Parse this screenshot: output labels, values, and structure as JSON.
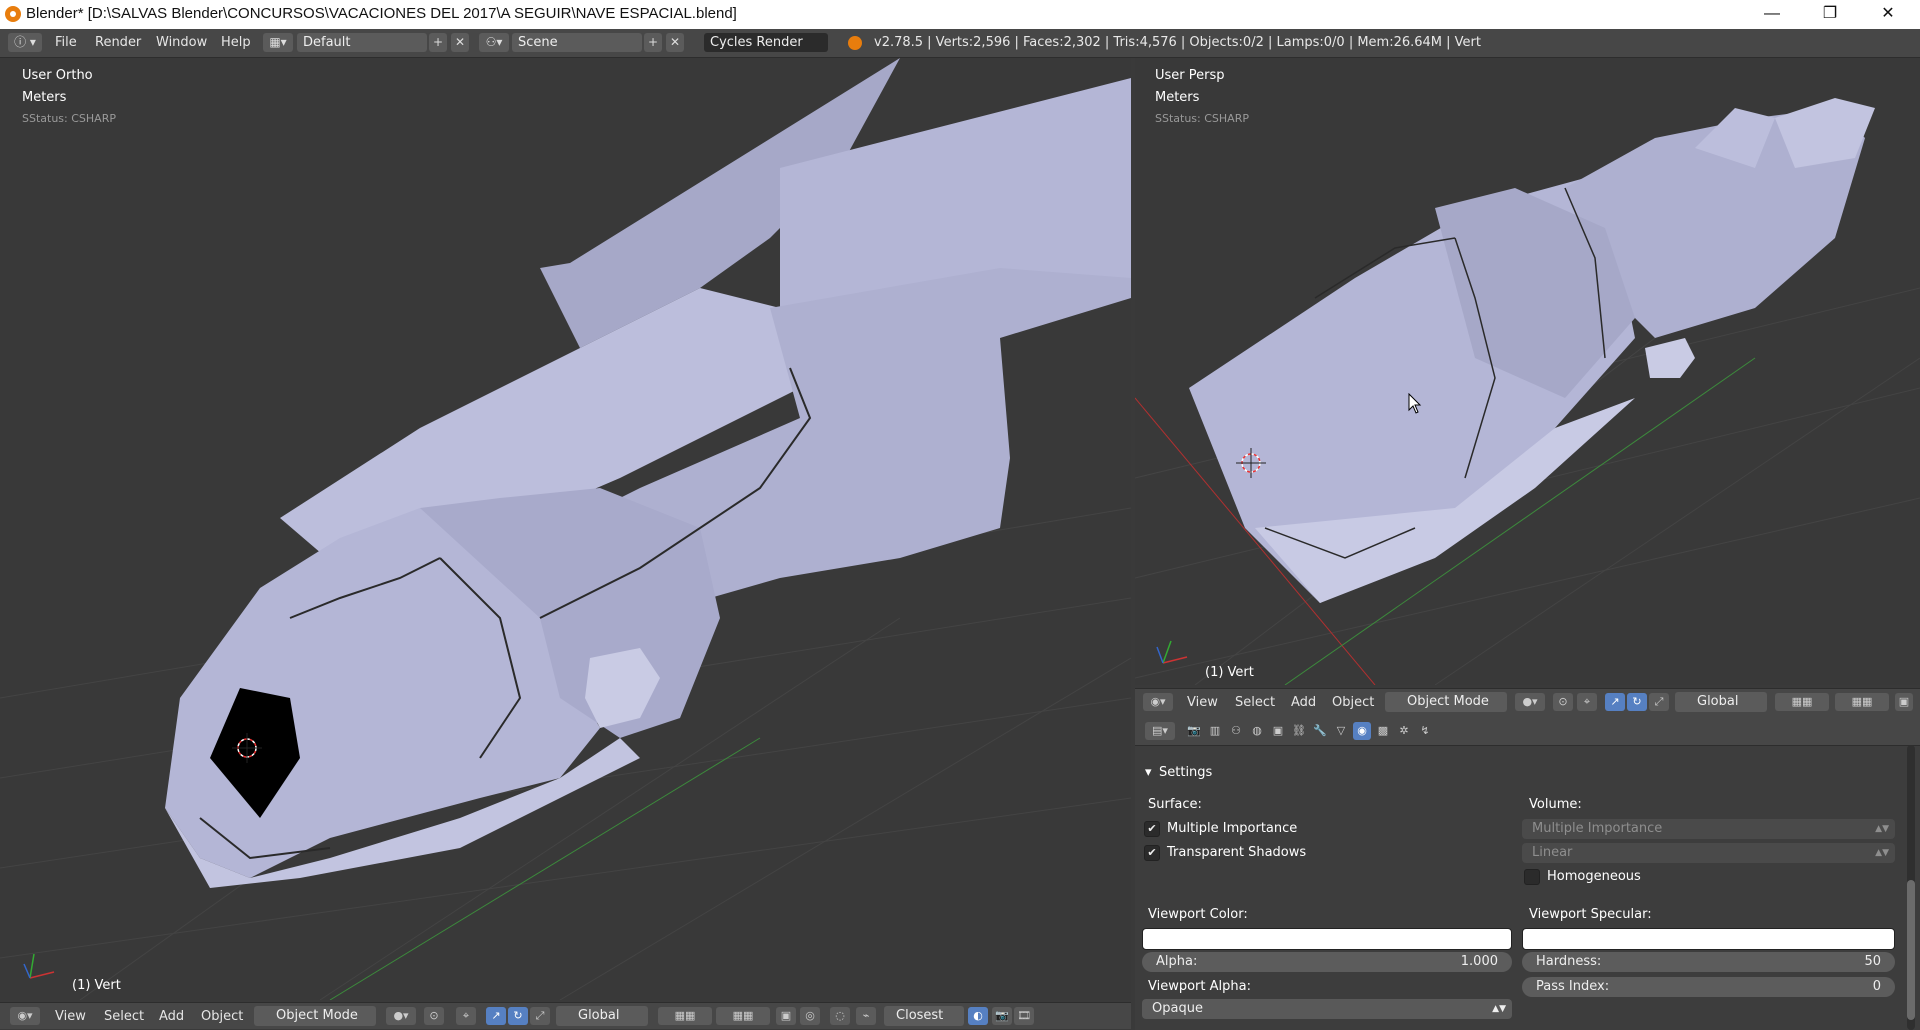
{
  "window": {
    "title": "Blender* [D:\\SALVAS Blender\\CONCURSOS\\VACACIONES DEL 2017\\A SEGUIR\\NAVE ESPACIAL.blend]",
    "minimize_glyph": "—",
    "restore_glyph": "❐",
    "close_glyph": "✕"
  },
  "topbar": {
    "menus": [
      "File",
      "Render",
      "Window",
      "Help"
    ],
    "screen_layout": "Default",
    "scene": "Scene",
    "render_engine": "Cycles Render",
    "stats": "v2.78.5 | Verts:2,596 | Faces:2,302 | Tris:4,576 | Objects:0/2 | Lamps:0/0 | Mem:26.64M | Vert"
  },
  "viewport_left": {
    "view_name": "User Ortho",
    "units": "Meters",
    "status": "SStatus: CSHARP",
    "object_label": "(1) Vert",
    "header": {
      "menus": [
        "View",
        "Select",
        "Add",
        "Object"
      ],
      "mode": "Object Mode",
      "orientation": "Global",
      "snap_target": "Closest"
    }
  },
  "viewport_right": {
    "view_name": "User Persp",
    "units": "Meters",
    "status": "SStatus: CSHARP",
    "object_label": "(1) Vert",
    "header": {
      "menus": [
        "View",
        "Select",
        "Add",
        "Object"
      ],
      "mode": "Object Mode",
      "orientation": "Global"
    }
  },
  "properties": {
    "panel_title": "Settings",
    "surface_label": "Surface:",
    "multiple_importance": "Multiple Importance",
    "transparent_shadows": "Transparent Shadows",
    "volume_label": "Volume:",
    "volume_sampling": "Multiple Importance",
    "volume_interpolation": "Linear",
    "homogeneous": "Homogeneous",
    "viewport_color_label": "Viewport Color:",
    "viewport_specular_label": "Viewport Specular:",
    "alpha_label": "Alpha:",
    "alpha_value": "1.000",
    "hardness_label": "Hardness:",
    "hardness_value": "50",
    "viewport_alpha_label": "Viewport Alpha:",
    "viewport_alpha_value": "Opaque",
    "pass_index_label": "Pass Index:",
    "pass_index_value": "0"
  },
  "colors": {
    "accent": "#5680c2",
    "viewport_bg": "#393939",
    "mesh": "#b4b6d6",
    "x_axis": "#b03030",
    "y_axis": "#3c8a3c"
  }
}
